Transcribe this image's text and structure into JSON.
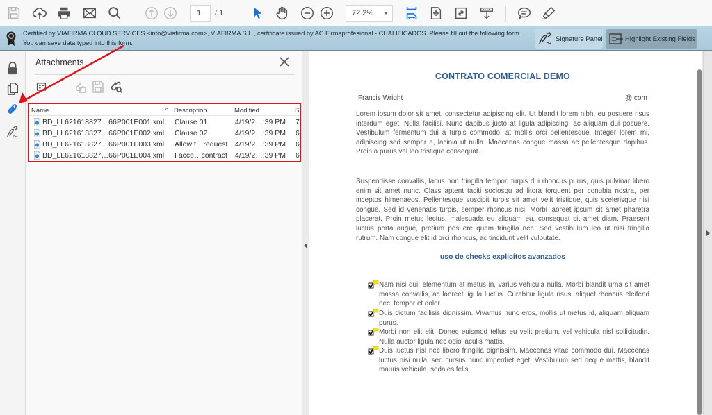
{
  "toolbar": {
    "icons": [
      "save-icon",
      "upload-cloud-icon",
      "print-icon",
      "email-icon",
      "search-icon",
      "previous-page-icon",
      "next-page-icon",
      "select-cursor-icon",
      "hand-tool-icon",
      "zoom-out-icon",
      "zoom-in-icon",
      "fit-width-icon",
      "fit-page-icon",
      "full-screen-icon",
      "read-mode-icon",
      "comment-icon",
      "highlight-pen-icon"
    ],
    "current_page": "1",
    "total_pages": "/ 1",
    "zoom_level": "72.2%"
  },
  "certbar": {
    "line1": "Certified by VIAFIRMA CLOUD SERVICES <info@viafirma.com>, VIAFIRMA S.L., certificate issued by AC Firmaprofesional - CUALIFICADOS.  Please fill out the following form.",
    "line2": "You can save data typed into this form.",
    "signature_panel_label": "Signature Panel",
    "highlight_fields_label": "Highlight Existing Fields"
  },
  "leftrail": {
    "icons": [
      "lock-icon",
      "pages-icon",
      "attachment-icon",
      "signature-icon"
    ],
    "active": "attachment-icon"
  },
  "attachments": {
    "title": "Attachments",
    "columns": [
      "Name",
      "Description",
      "Modified",
      "S"
    ],
    "sort_indicator": "^",
    "rows": [
      {
        "name": "BD_LL621618827…66P001E001.xml",
        "description": "Clause 01",
        "modified": "4/19/2…:39 PM",
        "size": "7"
      },
      {
        "name": "BD_LL621618827…66P001E002.xml",
        "description": "Clause 02",
        "modified": "4/19/2…:39 PM",
        "size": "6"
      },
      {
        "name": "BD_LL621618827…66P001E003.xml",
        "description": "Allow t…request",
        "modified": "4/19/2…:39 PM",
        "size": "6"
      },
      {
        "name": "BD_LL621618827…66P001E004.xml",
        "description": "I acce…contract",
        "modified": "4/19/2…:39 PM",
        "size": "6"
      }
    ]
  },
  "document": {
    "title": "CONTRATO COMERCIAL DEMO",
    "name": "Francis Wright",
    "email": "@.com",
    "paragraph1": "Lorem ipsum dolor sit amet, consectetur adipiscing elit. Ut blandit lorem nibh, eu posuere risus interdum eget. Nulla facilisi. Nunc dapibus justo at ligula adipiscing, ac aliquam dui posuere. Vestibulum fermentum dui a turpis commodo, at mollis orci pellentesque. Integer lorem mi, adipiscing sed semper a, lacinia ut nulla. Maecenas congue massa ac pellentesque dapibus. Proin a purus vel leo tristique consequat.",
    "paragraph2": "Suspendisse convallis, lacus non fringilla tempor, turpis dui rhoncus purus, quis pulvinar libero enim sit amet nunc. Class aptent taciti sociosqu ad litora torquent per conubia nostra, per inceptos himenaeos. Pellentesque suscipit turpis sit amet velit tristique, quis scelerisque nisi congue. Sed id venenatis turpis, semper rhoncus nisi. Morbi laoreet ipsum sit amet pharetra placerat. Proin metus lectus, malesuada eu aliquam eu, consequat sit amet diam. Praesent luctus porta augue, pretium posuere quam fringilla nec. Sed vestibulum leo ut nisi fringilla rutrum. Nam congue elit id orci rhoncus, ac tincidunt velit vulputate.",
    "subtitle": "uso de checks explicitos avanzados",
    "checks": [
      {
        "checked": true,
        "text": "Nam nisi dui, elementum at metus in, varius vehicula nulla. Morbi blandit urna sit amet massa convallis, ac laoreet ligula luctus. Curabitur ligula risus, aliquet rhoncus eleifend nec, tempor et dolor."
      },
      {
        "checked": true,
        "text": "Duis dictum facilisis dignissim. Vivamus nunc eros, mollis ut metus id, aliquam aliquam purus."
      },
      {
        "checked": true,
        "text": "Morbi non elit elit. Donec euismod tellus eu velit pretium, vel vehicula nisl sollicitudin. Nulla auctor ligula nec odio iaculis mattis."
      },
      {
        "checked": true,
        "text": "Duis luctus nisl nec libero fringilla dignissim. Maecenas vitae commodo dui. Maecenas luctus nisi nulla, sed cursus nunc imperdiet eget. Vestibulum sed neque mattis, blandit mauris vehicula, sodales felis."
      }
    ]
  },
  "colors": {
    "accent_blue": "#1a73d9",
    "annotation_red": "#e0141b",
    "doc_heading": "#2f5a97"
  }
}
